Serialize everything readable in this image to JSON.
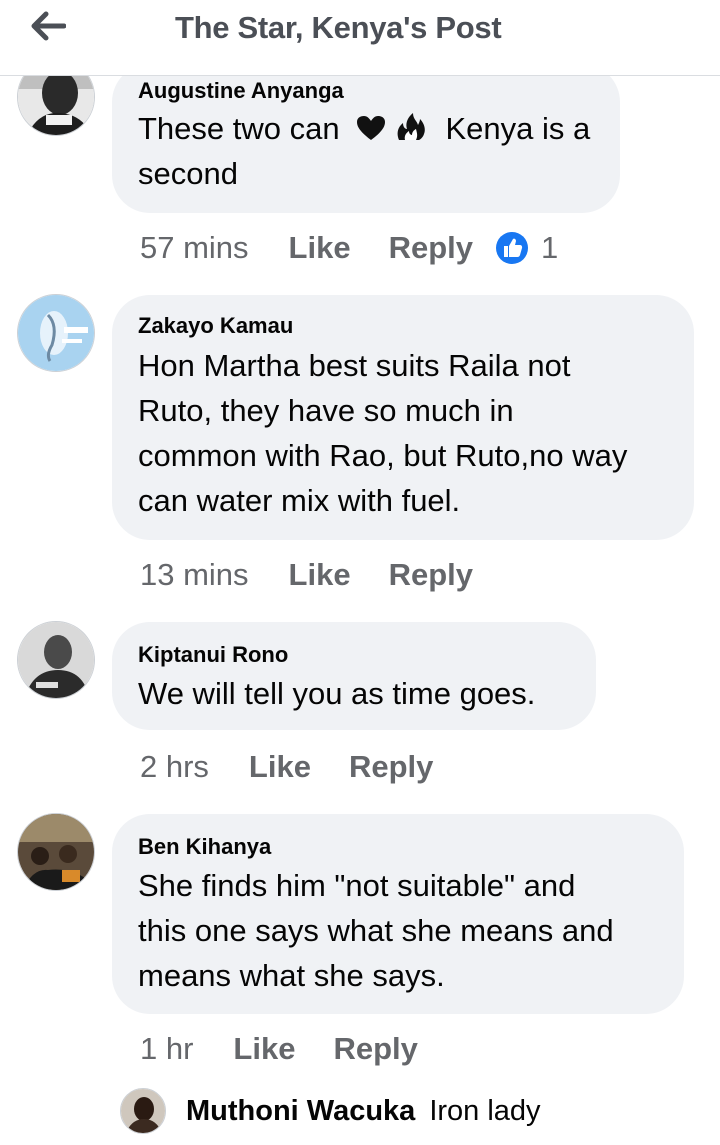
{
  "header": {
    "title": "The Star, Kenya's Post",
    "back_icon": "arrow-left-icon"
  },
  "comments": [
    {
      "author": "Augustine Anyanga",
      "lines": [
        "These two can",
        "Kenya is a",
        "second"
      ],
      "emoji": [
        "heart-icon",
        "fire-icon"
      ],
      "time": "57 mins",
      "like": "Like",
      "reply": "Reply",
      "reaction_count": "1",
      "reaction_icon": "thumbs-up-icon"
    },
    {
      "author": "Zakayo Kamau",
      "lines": [
        "Hon Martha best suits Raila not",
        "Ruto, they have so much in",
        "common with Rao, but Ruto,no way",
        "can water mix with fuel."
      ],
      "time": "13 mins",
      "like": "Like",
      "reply": "Reply"
    },
    {
      "author": "Kiptanui Rono",
      "lines": [
        "We will tell you as time goes."
      ],
      "time": "2 hrs",
      "like": "Like",
      "reply": "Reply"
    },
    {
      "author": "Ben Kihanya",
      "lines": [
        "She finds him \"not suitable\" and",
        "this one says what she means and",
        "means what she says."
      ],
      "time": "1 hr",
      "like": "Like",
      "reply": "Reply"
    }
  ],
  "reply_preview": {
    "author": "Muthoni Wacuka",
    "text": "Iron lady"
  },
  "colors": {
    "bubble": "#f0f2f5",
    "meta_text": "#65676b",
    "like_blue": "#1877f2",
    "title": "#4b4f56"
  }
}
